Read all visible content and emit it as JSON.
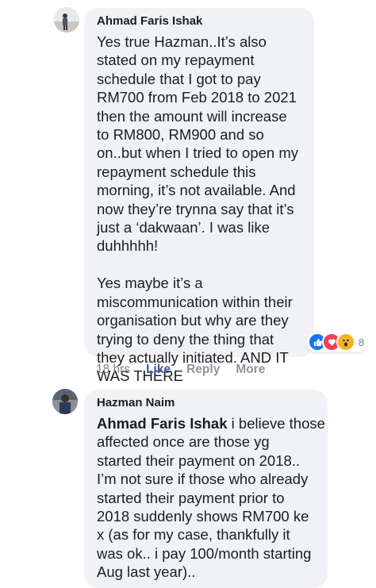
{
  "comments": [
    {
      "author": "Ahmad Faris Ishak",
      "text": "Yes true Hazman..It’s also\nstated on my repayment\nschedule that I got to pay\nRM700 from Feb 2018 to 2021\nthen the amount will increase\nto RM800, RM900 and so\non..but when I tried to open my\nrepayment schedule this\nmorning, it’s not available. And\nnow they’re trynna say that it’s\njust a ‘dakwaan’. I was like\nduhhhhh!\n\nYes maybe it’s a\nmiscommunication within their\norganisation but why are they\ntrying to deny the thing that\nthey actually initiated. AND IT\nWAS THERE",
      "time": "18 hrs",
      "like": "Like",
      "reply": "Reply",
      "more": "More",
      "reaction_count": "8",
      "reactions": [
        "like-icon",
        "love-icon",
        "wow-icon"
      ]
    },
    {
      "author": "Hazman Naim",
      "mention": "Ahmad Faris Ishak",
      "text": " i believe those\naffected once are those yg\nstarted their payment on 2018..\nI’m not sure if those who already\nstarted their payment prior to\n2018 suddenly shows RM700 ke\nx (as for my case, thankfully it\nwas ok.. i pay 100/month starting\nAug last year).."
    }
  ],
  "colors": {
    "bubble": "#f0f2f5",
    "like": "#385898",
    "meta": "#8d949e"
  }
}
